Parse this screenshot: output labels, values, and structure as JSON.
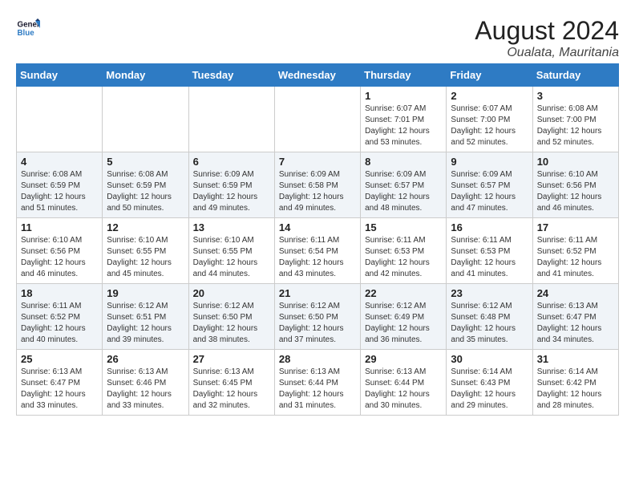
{
  "logo": {
    "line1": "General",
    "line2": "Blue"
  },
  "title": "August 2024",
  "location": "Oualata, Mauritania",
  "weekdays": [
    "Sunday",
    "Monday",
    "Tuesday",
    "Wednesday",
    "Thursday",
    "Friday",
    "Saturday"
  ],
  "weeks": [
    [
      {
        "day": "",
        "info": ""
      },
      {
        "day": "",
        "info": ""
      },
      {
        "day": "",
        "info": ""
      },
      {
        "day": "",
        "info": ""
      },
      {
        "day": "1",
        "info": "Sunrise: 6:07 AM\nSunset: 7:01 PM\nDaylight: 12 hours\nand 53 minutes."
      },
      {
        "day": "2",
        "info": "Sunrise: 6:07 AM\nSunset: 7:00 PM\nDaylight: 12 hours\nand 52 minutes."
      },
      {
        "day": "3",
        "info": "Sunrise: 6:08 AM\nSunset: 7:00 PM\nDaylight: 12 hours\nand 52 minutes."
      }
    ],
    [
      {
        "day": "4",
        "info": "Sunrise: 6:08 AM\nSunset: 6:59 PM\nDaylight: 12 hours\nand 51 minutes."
      },
      {
        "day": "5",
        "info": "Sunrise: 6:08 AM\nSunset: 6:59 PM\nDaylight: 12 hours\nand 50 minutes."
      },
      {
        "day": "6",
        "info": "Sunrise: 6:09 AM\nSunset: 6:59 PM\nDaylight: 12 hours\nand 49 minutes."
      },
      {
        "day": "7",
        "info": "Sunrise: 6:09 AM\nSunset: 6:58 PM\nDaylight: 12 hours\nand 49 minutes."
      },
      {
        "day": "8",
        "info": "Sunrise: 6:09 AM\nSunset: 6:57 PM\nDaylight: 12 hours\nand 48 minutes."
      },
      {
        "day": "9",
        "info": "Sunrise: 6:09 AM\nSunset: 6:57 PM\nDaylight: 12 hours\nand 47 minutes."
      },
      {
        "day": "10",
        "info": "Sunrise: 6:10 AM\nSunset: 6:56 PM\nDaylight: 12 hours\nand 46 minutes."
      }
    ],
    [
      {
        "day": "11",
        "info": "Sunrise: 6:10 AM\nSunset: 6:56 PM\nDaylight: 12 hours\nand 46 minutes."
      },
      {
        "day": "12",
        "info": "Sunrise: 6:10 AM\nSunset: 6:55 PM\nDaylight: 12 hours\nand 45 minutes."
      },
      {
        "day": "13",
        "info": "Sunrise: 6:10 AM\nSunset: 6:55 PM\nDaylight: 12 hours\nand 44 minutes."
      },
      {
        "day": "14",
        "info": "Sunrise: 6:11 AM\nSunset: 6:54 PM\nDaylight: 12 hours\nand 43 minutes."
      },
      {
        "day": "15",
        "info": "Sunrise: 6:11 AM\nSunset: 6:53 PM\nDaylight: 12 hours\nand 42 minutes."
      },
      {
        "day": "16",
        "info": "Sunrise: 6:11 AM\nSunset: 6:53 PM\nDaylight: 12 hours\nand 41 minutes."
      },
      {
        "day": "17",
        "info": "Sunrise: 6:11 AM\nSunset: 6:52 PM\nDaylight: 12 hours\nand 41 minutes."
      }
    ],
    [
      {
        "day": "18",
        "info": "Sunrise: 6:11 AM\nSunset: 6:52 PM\nDaylight: 12 hours\nand 40 minutes."
      },
      {
        "day": "19",
        "info": "Sunrise: 6:12 AM\nSunset: 6:51 PM\nDaylight: 12 hours\nand 39 minutes."
      },
      {
        "day": "20",
        "info": "Sunrise: 6:12 AM\nSunset: 6:50 PM\nDaylight: 12 hours\nand 38 minutes."
      },
      {
        "day": "21",
        "info": "Sunrise: 6:12 AM\nSunset: 6:50 PM\nDaylight: 12 hours\nand 37 minutes."
      },
      {
        "day": "22",
        "info": "Sunrise: 6:12 AM\nSunset: 6:49 PM\nDaylight: 12 hours\nand 36 minutes."
      },
      {
        "day": "23",
        "info": "Sunrise: 6:12 AM\nSunset: 6:48 PM\nDaylight: 12 hours\nand 35 minutes."
      },
      {
        "day": "24",
        "info": "Sunrise: 6:13 AM\nSunset: 6:47 PM\nDaylight: 12 hours\nand 34 minutes."
      }
    ],
    [
      {
        "day": "25",
        "info": "Sunrise: 6:13 AM\nSunset: 6:47 PM\nDaylight: 12 hours\nand 33 minutes."
      },
      {
        "day": "26",
        "info": "Sunrise: 6:13 AM\nSunset: 6:46 PM\nDaylight: 12 hours\nand 33 minutes."
      },
      {
        "day": "27",
        "info": "Sunrise: 6:13 AM\nSunset: 6:45 PM\nDaylight: 12 hours\nand 32 minutes."
      },
      {
        "day": "28",
        "info": "Sunrise: 6:13 AM\nSunset: 6:44 PM\nDaylight: 12 hours\nand 31 minutes."
      },
      {
        "day": "29",
        "info": "Sunrise: 6:13 AM\nSunset: 6:44 PM\nDaylight: 12 hours\nand 30 minutes."
      },
      {
        "day": "30",
        "info": "Sunrise: 6:14 AM\nSunset: 6:43 PM\nDaylight: 12 hours\nand 29 minutes."
      },
      {
        "day": "31",
        "info": "Sunrise: 6:14 AM\nSunset: 6:42 PM\nDaylight: 12 hours\nand 28 minutes."
      }
    ]
  ]
}
